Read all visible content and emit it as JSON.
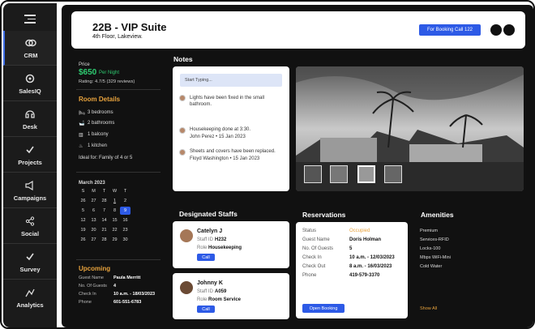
{
  "sidebar": {
    "items": [
      {
        "label": "CRM",
        "icon": "crm-icon"
      },
      {
        "label": "SalesIQ",
        "icon": "salesiq-icon"
      },
      {
        "label": "Desk",
        "icon": "desk-icon"
      },
      {
        "label": "Projects",
        "icon": "projects-icon"
      },
      {
        "label": "Campaigns",
        "icon": "campaigns-icon"
      },
      {
        "label": "Social",
        "icon": "social-icon"
      },
      {
        "label": "Survey",
        "icon": "survey-icon"
      },
      {
        "label": "Analytics",
        "icon": "analytics-icon"
      }
    ]
  },
  "header": {
    "title": "22B - VIP Suite",
    "subtitle": "4th Floor, Lakeview.",
    "booking_button": "For Booking Call 122"
  },
  "price": {
    "label": "Price",
    "amount": "$650",
    "per": "Per Night",
    "rating": "Rating: 4.7/5 (329 reviews)"
  },
  "room_details": {
    "title": "Room Details",
    "items": [
      "3 bedrooms",
      "2 bathrooms",
      "1 balcony",
      "1 kitchen"
    ],
    "ideal": "Ideal for: Family of 4 or 5"
  },
  "calendar": {
    "month": "March 2023",
    "days": [
      "S",
      "M",
      "T",
      "W",
      "T"
    ],
    "rows": [
      [
        "26",
        "27",
        "28",
        "1",
        "2"
      ],
      [
        "5",
        "6",
        "7",
        "8",
        "9"
      ],
      [
        "12",
        "13",
        "14",
        "15",
        "16"
      ],
      [
        "19",
        "20",
        "21",
        "22",
        "23"
      ],
      [
        "26",
        "27",
        "28",
        "29",
        "30"
      ]
    ]
  },
  "upcoming": {
    "title": "Upcoming",
    "rows": [
      {
        "k": "Guest Name",
        "v": "Paula Merritt"
      },
      {
        "k": "No. Of Guests",
        "v": "4"
      },
      {
        "k": "Check In",
        "v": "10 a.m. - 18/03/2023"
      },
      {
        "k": "Phone",
        "v": "601-551-6783"
      }
    ]
  },
  "notes": {
    "title": "Notes",
    "placeholder": "Start Typing...",
    "items": [
      {
        "text": "Lights have been fixed in the small bathroom.",
        "meta": ""
      },
      {
        "text": "Housekeeping done at 3:30.",
        "meta": "John Perez  •  15 Jan 2023"
      },
      {
        "text": "Sheets and covers have been replaced.",
        "meta": "Floyd Washington  •  15 Jan 2023"
      }
    ]
  },
  "staff": {
    "title": "Designated Staffs",
    "items": [
      {
        "name": "Catelyn J",
        "id_label": "Staff ID",
        "id": "H232",
        "role_label": "Role",
        "role": "Housekeeping",
        "call": "Call"
      },
      {
        "name": "Johnny K",
        "id_label": "Staff ID",
        "id": "A059",
        "role_label": "Role",
        "role": "Room Service",
        "call": "Call"
      }
    ]
  },
  "reservations": {
    "title": "Reservations",
    "rows": [
      {
        "k": "Status",
        "v": "Occupied"
      },
      {
        "k": "Guest Name",
        "v": "Doris Holman"
      },
      {
        "k": "No. Of Guests",
        "v": "5"
      },
      {
        "k": "Check In",
        "v": "10 a.m. - 12/03/2023"
      },
      {
        "k": "Check Out",
        "v": "8 a.m. - 16/03/2023"
      },
      {
        "k": "Phone",
        "v": "419-579-3370"
      }
    ],
    "open_button": "Open Booking"
  },
  "amenities": {
    "title": "Amenities",
    "items": [
      "Premium",
      "Services-RFID",
      "Locks-100",
      "Mbps WiFi-Mini",
      "Cold Water"
    ],
    "show_all": "Show All"
  },
  "colors": {
    "accent": "#2d5ae6",
    "gold": "#e8a33d",
    "price_green": "#2ecc71"
  }
}
